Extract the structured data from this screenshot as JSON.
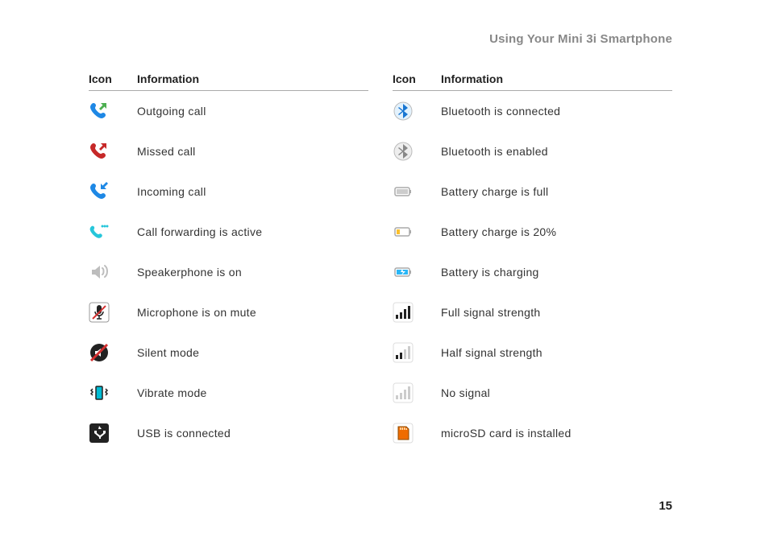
{
  "header": "Using Your Mini 3i Smartphone",
  "page_number": "15",
  "table": {
    "col_headers": {
      "icon": "Icon",
      "info": "Information"
    },
    "left": [
      {
        "icon": "outgoing-call-icon",
        "label": "Outgoing call"
      },
      {
        "icon": "missed-call-icon",
        "label": "Missed call"
      },
      {
        "icon": "incoming-call-icon",
        "label": "Incoming call"
      },
      {
        "icon": "call-forwarding-icon",
        "label": "Call forwarding is active"
      },
      {
        "icon": "speakerphone-icon",
        "label": "Speakerphone is on"
      },
      {
        "icon": "microphone-mute-icon",
        "label": "Microphone is on mute"
      },
      {
        "icon": "silent-mode-icon",
        "label": "Silent mode"
      },
      {
        "icon": "vibrate-mode-icon",
        "label": "Vibrate mode"
      },
      {
        "icon": "usb-connected-icon",
        "label": "USB is connected"
      }
    ],
    "right": [
      {
        "icon": "bluetooth-connected-icon",
        "label": "Bluetooth is connected"
      },
      {
        "icon": "bluetooth-enabled-icon",
        "label": "Bluetooth is enabled"
      },
      {
        "icon": "battery-full-icon",
        "label": "Battery charge is full"
      },
      {
        "icon": "battery-20-icon",
        "label": "Battery charge is 20%"
      },
      {
        "icon": "battery-charging-icon",
        "label": "Battery is charging"
      },
      {
        "icon": "signal-full-icon",
        "label": "Full signal strength"
      },
      {
        "icon": "signal-half-icon",
        "label": "Half signal strength"
      },
      {
        "icon": "signal-none-icon",
        "label": "No signal"
      },
      {
        "icon": "microsd-icon",
        "label": "microSD card is installed"
      }
    ]
  }
}
